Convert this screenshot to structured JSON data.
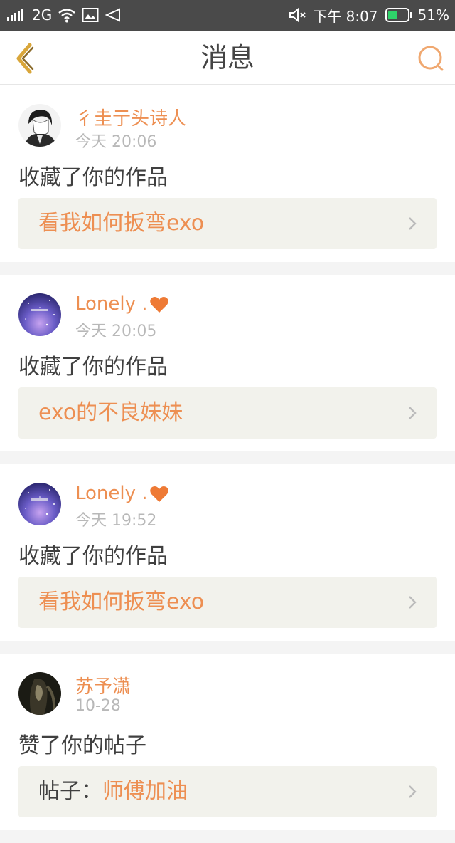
{
  "status_bar": {
    "network": "2G",
    "time": "下午 8:07",
    "battery_percent_text": "51%",
    "battery_level": 0.51,
    "battery_color": "#2fd36a"
  },
  "header": {
    "title": "消息"
  },
  "colors": {
    "accent": "#ed8f52",
    "body_text": "#404040",
    "time_text": "#b8b8b8",
    "link_box_bg": "#f2f2ec"
  },
  "messages": [
    {
      "user": "彳圭亍头诗人",
      "time": "今天 20:06",
      "action": "收藏了你的作品",
      "target_prefix": "",
      "target": "看我如何扳弯exo"
    },
    {
      "user": "Lonely .",
      "time": "今天 20:05",
      "action": "收藏了你的作品",
      "target_prefix": "",
      "target": "exo的不良妹妹"
    },
    {
      "user": "Lonely .",
      "time": "今天 19:52",
      "action": "收藏了你的作品",
      "target_prefix": "",
      "target": "看我如何扳弯exo"
    },
    {
      "user": "苏予潇",
      "time": "10-28",
      "action": "赞了你的帖子",
      "target_prefix": "帖子：",
      "target": "师傅加油"
    }
  ]
}
